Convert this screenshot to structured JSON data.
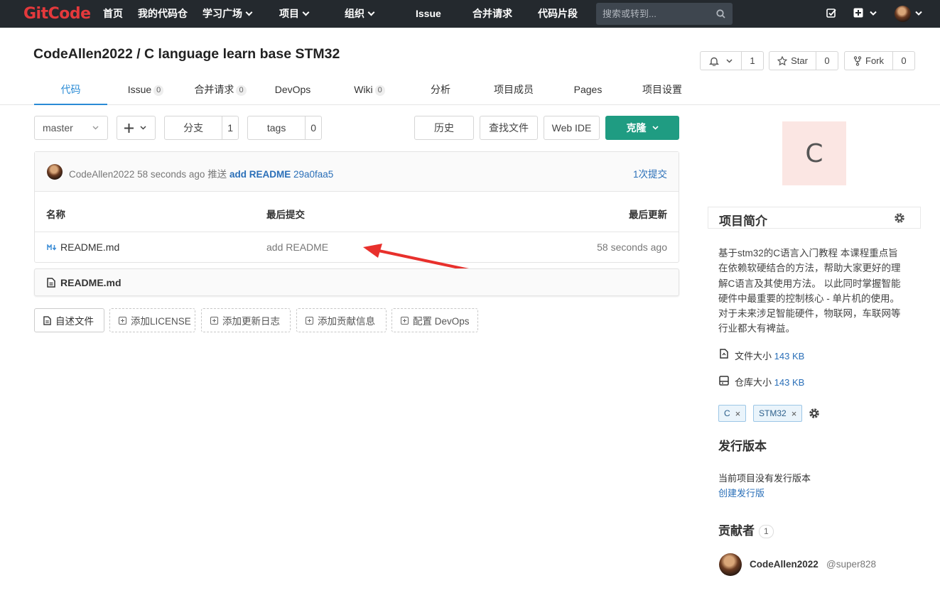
{
  "topbar": {
    "logo": "GitCode",
    "nav": [
      "首页",
      "我的代码仓",
      "学习广场",
      "项目",
      "组织",
      "Issue",
      "合并请求",
      "代码片段"
    ],
    "search_placeholder": "搜索或转到..."
  },
  "repo": {
    "title": "CodeAllen2022 / C language learn base STM32",
    "watch_count": "1",
    "star_label": "Star",
    "star_count": "0",
    "fork_label": "Fork",
    "fork_count": "0"
  },
  "tabs": [
    {
      "label": "代码",
      "badge": ""
    },
    {
      "label": "Issue",
      "badge": "0"
    },
    {
      "label": "合并请求",
      "badge": "0"
    },
    {
      "label": "DevOps",
      "badge": ""
    },
    {
      "label": "Wiki",
      "badge": "0"
    },
    {
      "label": "分析",
      "badge": ""
    },
    {
      "label": "项目成员",
      "badge": ""
    },
    {
      "label": "Pages",
      "badge": ""
    },
    {
      "label": "项目设置",
      "badge": ""
    }
  ],
  "toolbar": {
    "branch": "master",
    "branches_label": "分支",
    "branches_count": "1",
    "tags_label": "tags",
    "tags_count": "0",
    "history": "历史",
    "find_file": "查找文件",
    "web_ide": "Web IDE",
    "clone": "克隆"
  },
  "commit": {
    "author": "CodeAllen2022",
    "time": "58 seconds ago",
    "action": "推送",
    "message": "add README",
    "sha": "29a0faa5",
    "count": "1次提交"
  },
  "files": {
    "headers": [
      "名称",
      "最后提交",
      "最后更新"
    ],
    "rows": [
      {
        "name": "README.md",
        "commit": "add README",
        "updated": "58 seconds ago"
      }
    ]
  },
  "readme": {
    "title": "README.md"
  },
  "actions": [
    "自述文件",
    "添加LICENSE",
    "添加更新日志",
    "添加贡献信息",
    "配置 DevOps"
  ],
  "sidebar": {
    "avatar_letter": "C",
    "intro_title": "项目简介",
    "description_lines": [
      "基于stm32的C语言入门教程 本课程重点旨",
      "在依赖软硬结合的方法，帮助大家更好的理",
      "解C语言及其使用方法。 以此同时掌握智能",
      "硬件中最重要的控制核心 - 单片机的使用。",
      "对于未来涉足智能硬件，物联网，车联网等",
      "行业都大有裨益。"
    ],
    "file_size_label": "文件大小",
    "file_size": "143 KB",
    "repo_size_label": "仓库大小",
    "repo_size": "143 KB",
    "topics": [
      "C",
      "STM32"
    ],
    "releases_title": "发行版本",
    "releases_empty": "当前项目没有发行版本",
    "create_release": "创建发行版",
    "contributors_title": "贡献者",
    "contributors_count": "1",
    "contributor_name": "CodeAllen2022",
    "contributor_handle": "@super828"
  },
  "colors": {
    "accent": "#2a8bd5",
    "clone": "#1f9c82",
    "logo": "#e4393c",
    "arrow": "#e8302c"
  }
}
